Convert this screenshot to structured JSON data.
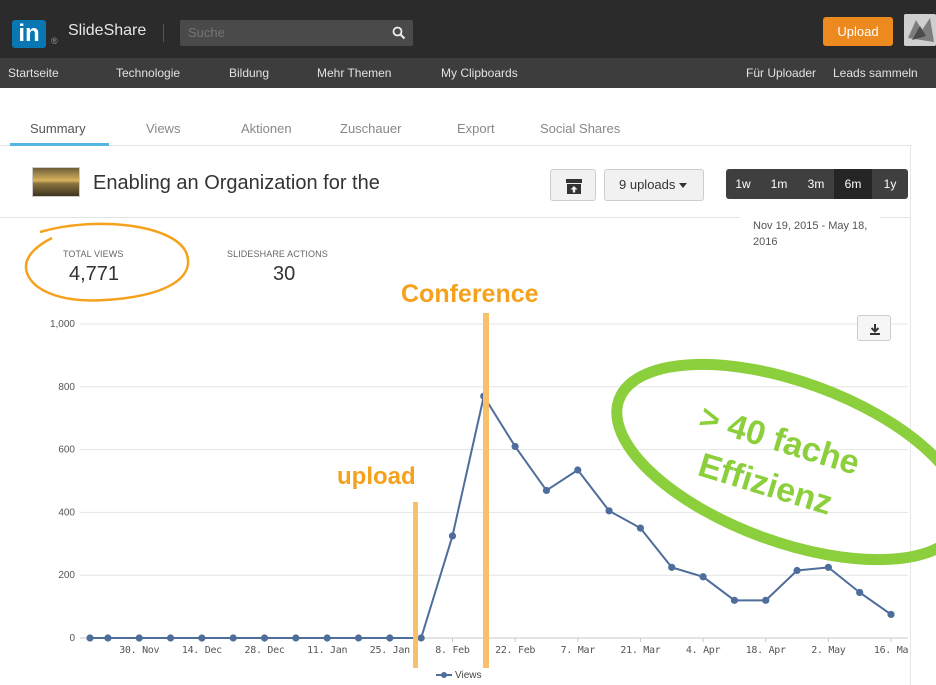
{
  "topbar": {
    "logo_text": "in",
    "logo_reg": "®",
    "brand": "SlideShare",
    "search_placeholder": "Suche",
    "upload_label": "Upload"
  },
  "nav": {
    "items": [
      "Startseite",
      "Technologie",
      "Bildung",
      "Mehr Themen",
      "My Clipboards"
    ],
    "right_items": [
      "Für Uploader",
      "Leads sammeln"
    ]
  },
  "tabs": [
    "Summary",
    "Views",
    "Aktionen",
    "Zuschauer",
    "Export",
    "Social Shares"
  ],
  "active_tab": "Summary",
  "presentation": {
    "title": "Enabling an Organization for the",
    "uploads_label": "9 uploads",
    "ranges": [
      "1w",
      "1m",
      "3m",
      "6m",
      "1y"
    ],
    "active_range": "6m",
    "date_range_line1": "Nov 19, 2015 - May 18,",
    "date_range_line2": "2016"
  },
  "stats": {
    "total_views_label": "TOTAL VIEWS",
    "total_views": "4,771",
    "actions_label": "SLIDESHARE ACTIONS",
    "actions": "30"
  },
  "annotations": {
    "conference": "Conference",
    "upload": "upload",
    "effizienz_line1": "> 40 fache",
    "effizienz_line2": "Effizienz",
    "orange": "#f5a11c",
    "green": "#8ccf3c"
  },
  "chart_data": {
    "type": "line",
    "x": [
      "2015-11-19",
      "2015-11-23",
      "2015-11-30",
      "2015-12-07",
      "2015-12-14",
      "2015-12-21",
      "2015-12-28",
      "2016-01-04",
      "2016-01-11",
      "2016-01-18",
      "2016-01-25",
      "2016-02-01",
      "2016-02-08",
      "2016-02-15",
      "2016-02-22",
      "2016-02-29",
      "2016-03-07",
      "2016-03-14",
      "2016-03-21",
      "2016-03-28",
      "2016-04-04",
      "2016-04-11",
      "2016-04-18",
      "2016-04-25",
      "2016-05-02",
      "2016-05-09",
      "2016-05-16"
    ],
    "series": [
      {
        "name": "Views",
        "color": "#4f6d9b",
        "values": [
          0,
          0,
          0,
          0,
          0,
          0,
          0,
          0,
          0,
          0,
          0,
          0,
          325,
          770,
          610,
          470,
          535,
          405,
          350,
          225,
          195,
          120,
          120,
          215,
          225,
          145,
          75
        ]
      }
    ],
    "x_tick_labels": [
      "30. Nov",
      "14. Dec",
      "28. Dec",
      "11. Jan",
      "25. Jan",
      "8. Feb",
      "22. Feb",
      "7. Mar",
      "21. Mar",
      "4. Apr",
      "18. Apr",
      "2. May",
      "16. Ma"
    ],
    "y_ticks": [
      "0",
      "200",
      "400",
      "600",
      "800",
      "1,000"
    ],
    "ylim": [
      0,
      1000
    ],
    "grid": true,
    "legend_position": "bottom-center"
  }
}
